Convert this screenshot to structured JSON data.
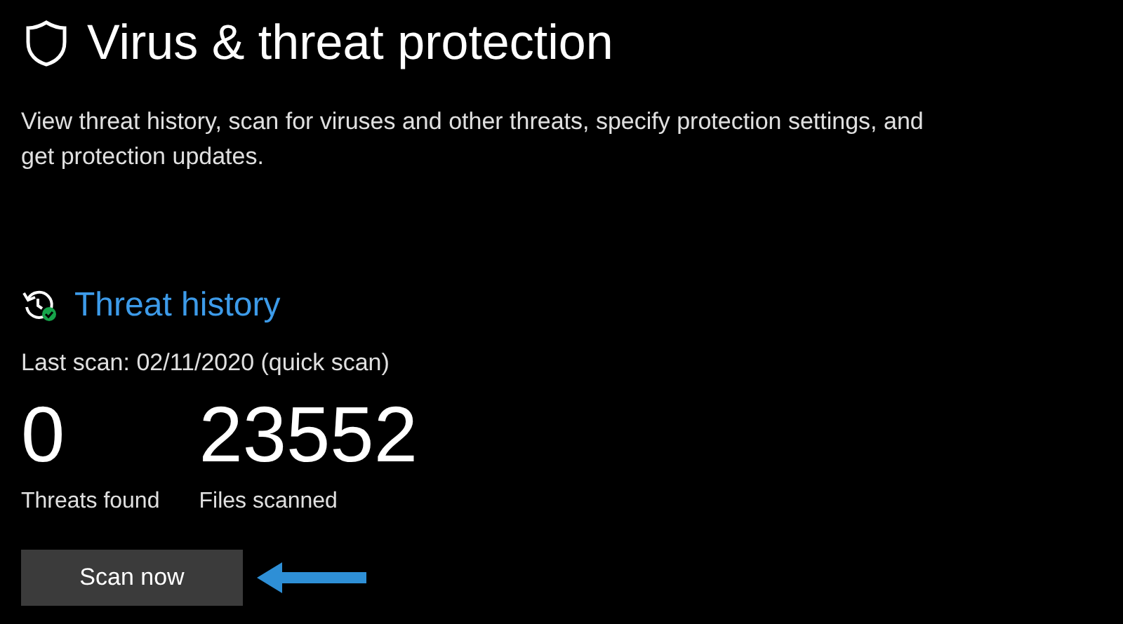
{
  "page": {
    "title": "Virus & threat protection",
    "description": "View threat history, scan for viruses and other threats, specify protection settings, and get protection updates."
  },
  "threat_history": {
    "link": "Threat history",
    "last_scan": "Last scan: 02/11/2020 (quick scan)",
    "stats": [
      {
        "value": "0",
        "label": "Threats found"
      },
      {
        "value": "23552",
        "label": "Files scanned"
      }
    ],
    "button": "Scan now"
  }
}
